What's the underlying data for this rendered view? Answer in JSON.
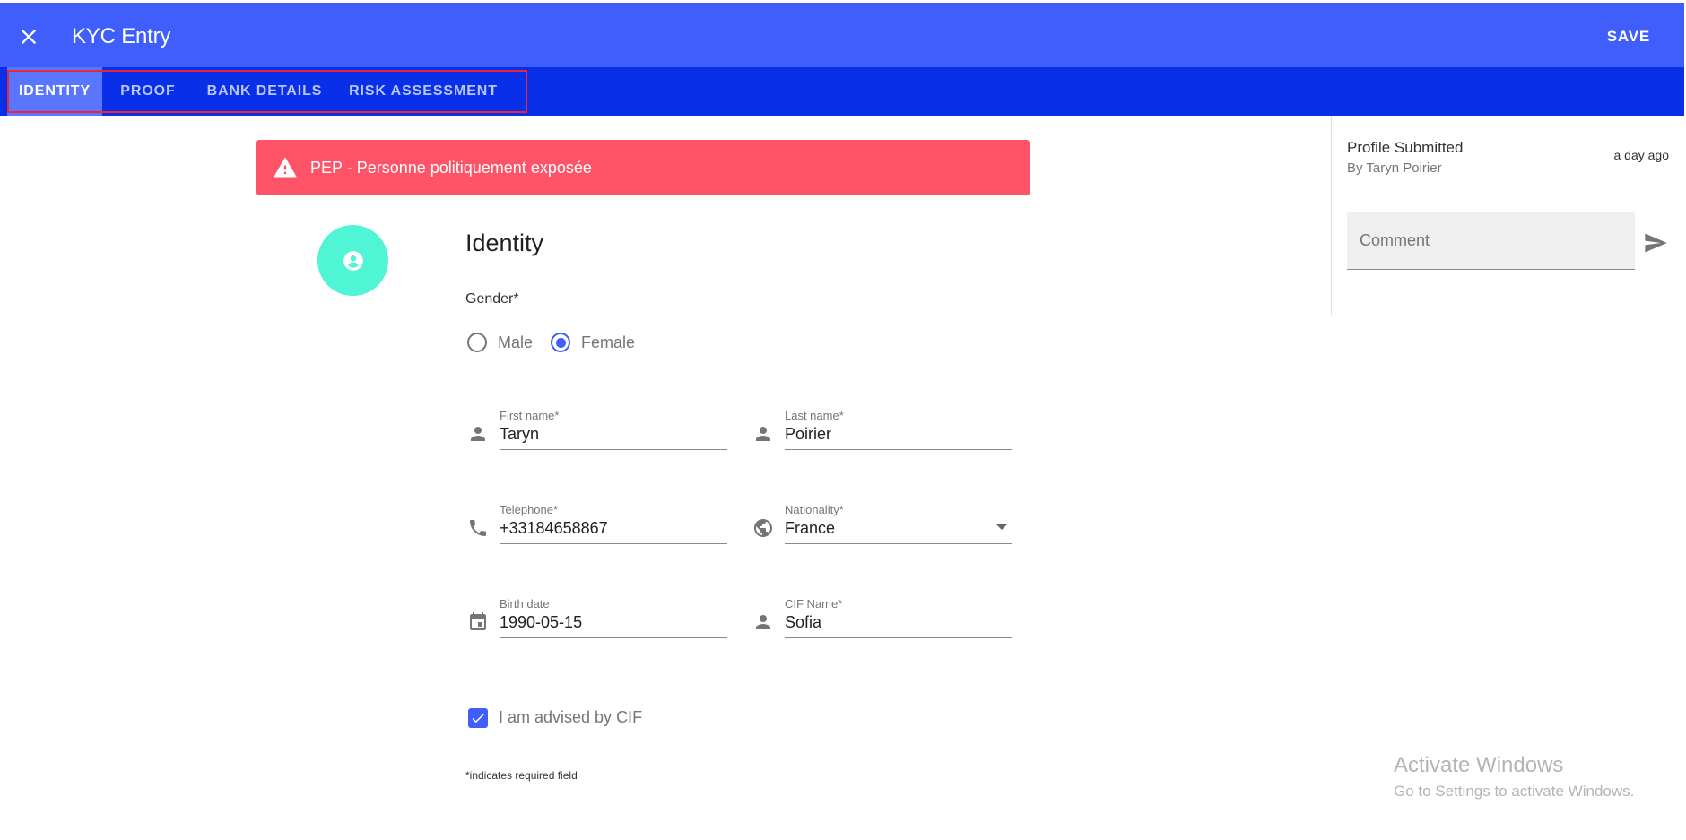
{
  "appbar": {
    "title": "KYC Entry",
    "save_label": "SAVE",
    "color": "#3f5efb"
  },
  "tabs": [
    {
      "label": "IDENTITY",
      "active": true
    },
    {
      "label": "PROOF",
      "active": false
    },
    {
      "label": "BANK DETAILS",
      "active": false
    },
    {
      "label": "RISK ASSESSMENT",
      "active": false
    }
  ],
  "alert": {
    "icon": "warning-icon",
    "text": "PEP - Personne politiquement exposée",
    "color": "#ff5468"
  },
  "avatar": {
    "icon": "account-circle-icon",
    "color": "#4ff5d4"
  },
  "identity": {
    "title": "Identity",
    "gender_label": "Gender*",
    "gender_options": [
      {
        "label": "Male",
        "checked": false
      },
      {
        "label": "Female",
        "checked": true
      }
    ],
    "fields": {
      "first_name": {
        "label": "First name*",
        "value": "Taryn",
        "icon": "person-icon"
      },
      "last_name": {
        "label": "Last name*",
        "value": "Poirier",
        "icon": "person-icon"
      },
      "telephone": {
        "label": "Telephone*",
        "value": "+33184658867",
        "icon": "phone-icon"
      },
      "nationality": {
        "label": "Nationality*",
        "value": "France",
        "icon": "globe-icon"
      },
      "birth_date": {
        "label": "Birth date",
        "value": "1990-05-15",
        "icon": "calendar-icon"
      },
      "cif_name": {
        "label": "CIF Name*",
        "value": "Sofia",
        "icon": "person-icon"
      }
    },
    "advised_checkbox": {
      "label": "I am advised by CIF",
      "checked": true
    },
    "required_note": "*indicates required field"
  },
  "sidepanel": {
    "event_title": "Profile Submitted",
    "event_by": "By Taryn Poirier",
    "event_time": "a day ago",
    "comment_placeholder": "Comment"
  },
  "watermark": {
    "title": "Activate Windows",
    "subtitle": "Go to Settings to activate Windows."
  }
}
